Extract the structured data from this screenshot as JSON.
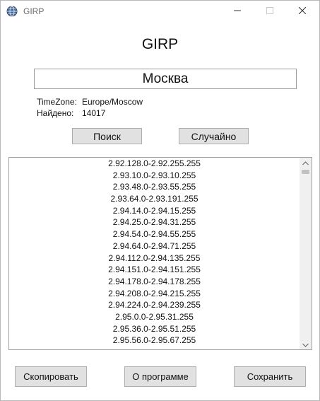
{
  "window": {
    "title": "GIRP"
  },
  "app": {
    "heading": "GIRP"
  },
  "search": {
    "value": "Москва"
  },
  "info": {
    "timezone_label": "TimeZone:",
    "timezone_value": "Europe/Moscow",
    "found_label": "Найдено:",
    "found_value": "14017"
  },
  "buttons": {
    "search": "Поиск",
    "random": "Случайно",
    "copy": "Скопировать",
    "about": "О программе",
    "save": "Сохранить"
  },
  "ranges": [
    "2.92.128.0-2.92.255.255",
    "2.93.10.0-2.93.10.255",
    "2.93.48.0-2.93.55.255",
    "2.93.64.0-2.93.191.255",
    "2.94.14.0-2.94.15.255",
    "2.94.25.0-2.94.31.255",
    "2.94.54.0-2.94.55.255",
    "2.94.64.0-2.94.71.255",
    "2.94.112.0-2.94.135.255",
    "2.94.151.0-2.94.151.255",
    "2.94.178.0-2.94.178.255",
    "2.94.208.0-2.94.215.255",
    "2.94.224.0-2.94.239.255",
    "2.95.0.0-2.95.31.255",
    "2.95.36.0-2.95.51.255",
    "2.95.56.0-2.95.67.255"
  ],
  "icons": {
    "app": "globe-icon",
    "minimize": "minimize-icon",
    "maximize": "maximize-icon",
    "close": "close-icon",
    "scroll_up": "chevron-up-icon",
    "scroll_down": "chevron-down-icon"
  }
}
